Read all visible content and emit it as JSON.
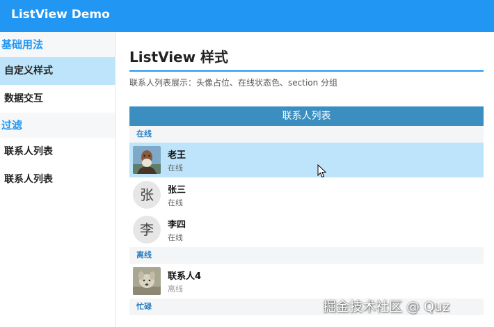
{
  "app": {
    "title": "ListView Demo",
    "accent": "#2196f3"
  },
  "sidebar": {
    "groups": [
      {
        "label": "基础用法",
        "items": [
          {
            "label": "自定义样式",
            "active": true
          },
          {
            "label": "数据交互"
          }
        ]
      },
      {
        "label": "过滤",
        "items": [
          {
            "label": "联系人列表"
          },
          {
            "label": "联系人列表"
          }
        ]
      }
    ]
  },
  "main": {
    "title": "ListView 样式",
    "description": "联系人列表展示：头像占位、在线状态色、section 分组"
  },
  "list": {
    "header": "联系人列表",
    "sections": [
      {
        "label": "在线",
        "contacts": [
          {
            "name": "老王",
            "status": "在线",
            "avatar": "photo-icon"
          },
          {
            "name": "张三",
            "status": "在线",
            "avatar_char": "张"
          },
          {
            "name": "李四",
            "status": "在线",
            "avatar_char": "李"
          }
        ]
      },
      {
        "label": "离线",
        "contacts": [
          {
            "name": "联系人4",
            "status": "离线",
            "avatar": "photo-icon"
          }
        ]
      },
      {
        "label": "忙碌",
        "contacts": []
      }
    ],
    "colors": {
      "header_bg": "#3a8ec0",
      "section_text": "#2b80c4",
      "hover_bg": "#bde4fa"
    }
  },
  "watermark": "掘金技术社区 @ Quz"
}
